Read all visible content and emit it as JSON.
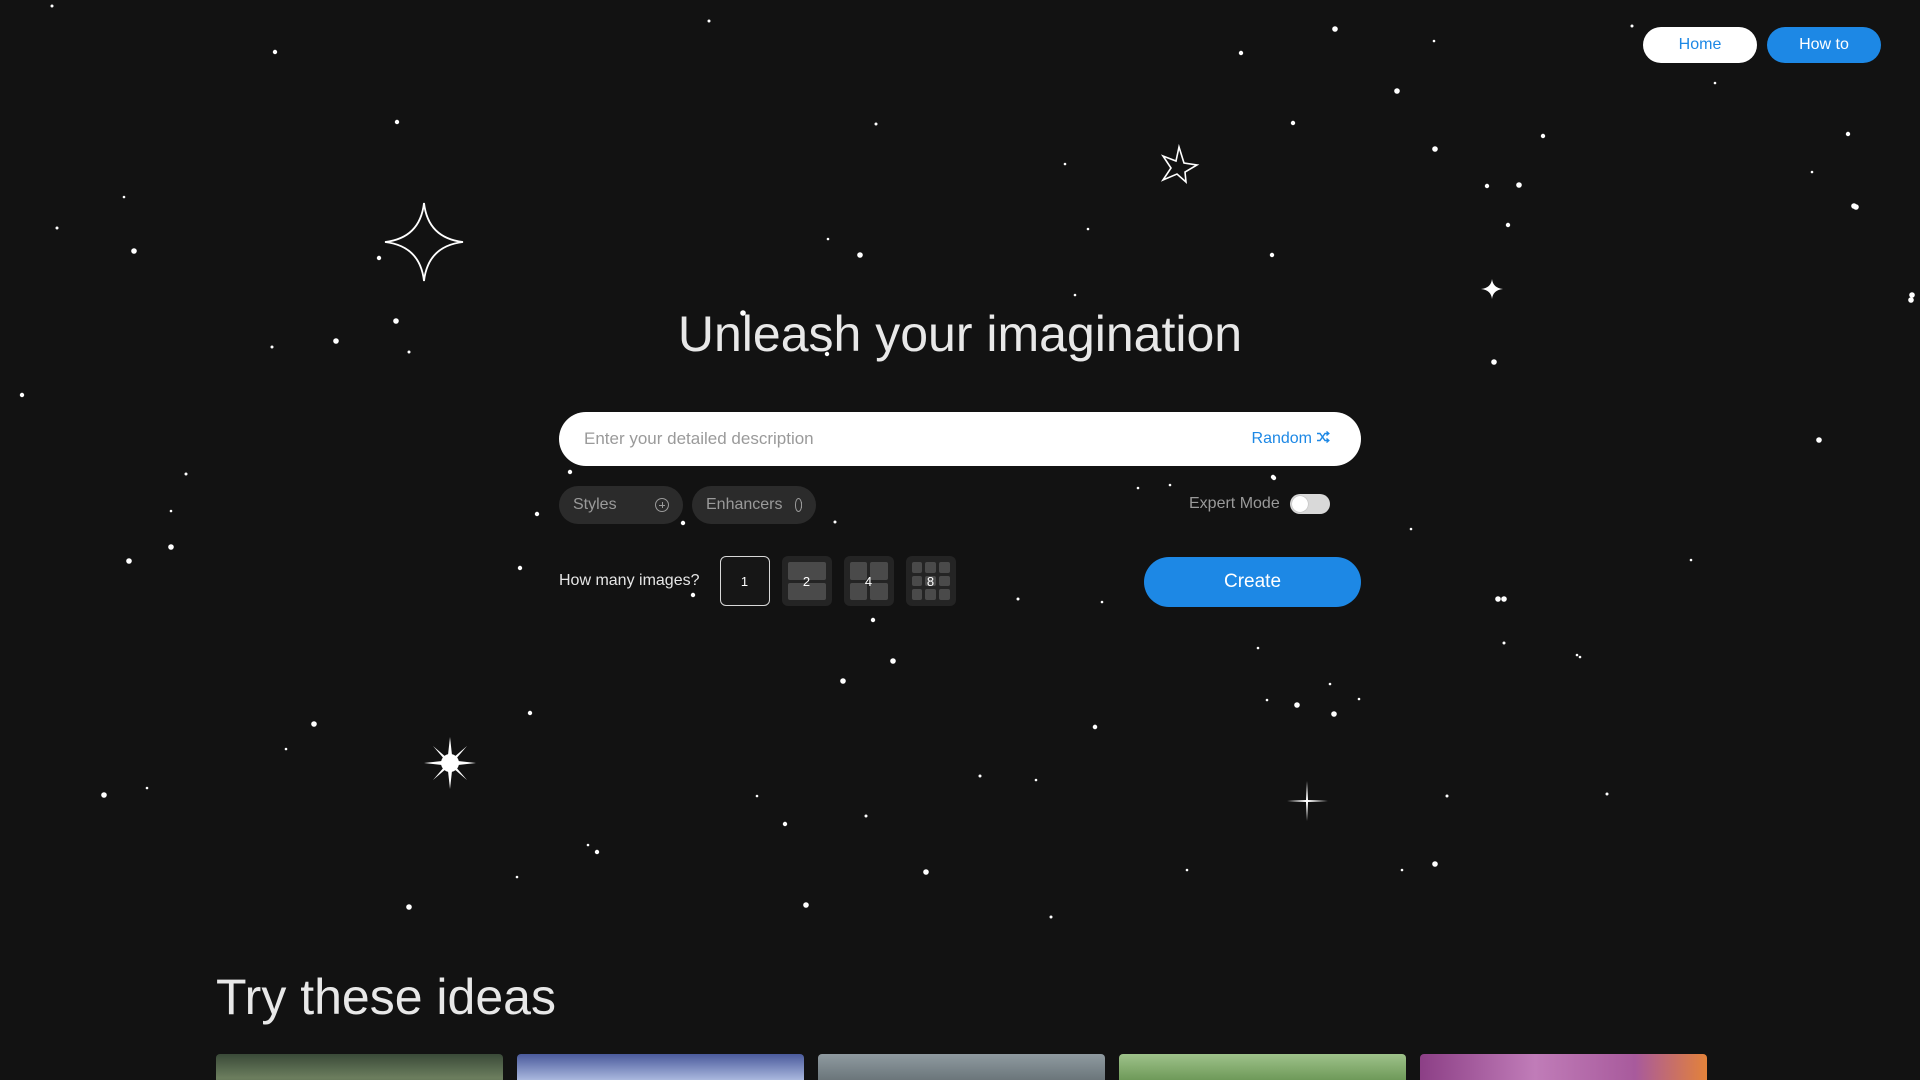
{
  "nav": {
    "home_label": "Home",
    "howto_label": "How to"
  },
  "hero": {
    "title": "Unleash your imagination"
  },
  "prompt": {
    "placeholder": "Enter your detailed description",
    "value": "",
    "random_label": "Random"
  },
  "options": {
    "styles_label": "Styles",
    "enhancers_label": "Enhancers",
    "expert_mode_label": "Expert Mode",
    "expert_mode_on": false
  },
  "image_count": {
    "label": "How many images?",
    "options": [
      "1",
      "2",
      "4",
      "8"
    ],
    "selected": "1"
  },
  "create_label": "Create",
  "ideas": {
    "title": "Try these ideas"
  },
  "colors": {
    "accent": "#1d88e5",
    "background": "#121212"
  }
}
